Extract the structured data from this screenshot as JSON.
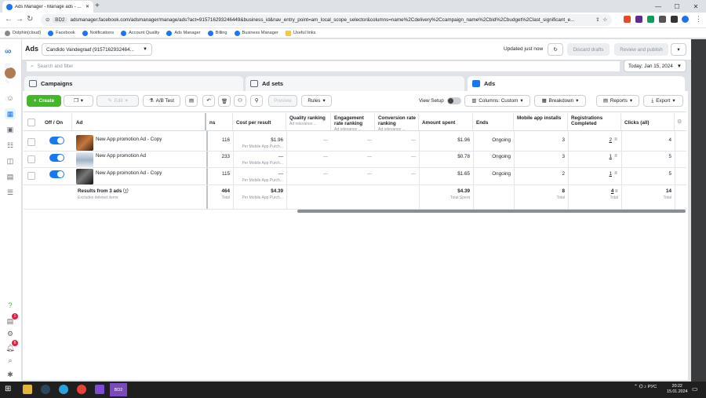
{
  "browser": {
    "tab_title": "Ads Manager - Manage ads - A...",
    "new_tab": "+",
    "url_chip": "BD2",
    "url": "adsmanager.facebook.com/adsmanager/manage/ads?act=915716293246449&business_id&nav_entry_point=am_local_scope_selector&columns=name%2Cdelivery%2Ccampaign_name%2Cbid%2Cbudget%2Clast_significant_e...",
    "bookmarks": [
      "Dolphin{cloud}",
      "Facebook",
      "Notifications",
      "Account Quality",
      "Ads Manager",
      "Billing",
      "Business Manager",
      "Useful links"
    ]
  },
  "header": {
    "title": "Ads",
    "account": "Candido Vandegraaf (9157162932464...",
    "updated": "Updated just now",
    "discard_drafts": "Discard drafts",
    "review_publish": "Review and publish"
  },
  "search": {
    "placeholder": "Search and filter"
  },
  "date_range": "Today: Jan 15, 2024",
  "level_tabs": {
    "campaigns": "Campaigns",
    "adsets": "Ad sets",
    "ads": "Ads"
  },
  "toolbar": {
    "create": "Create",
    "edit": "Edit",
    "ab_test": "A/B Test",
    "preview": "Preview",
    "rules": "Rules",
    "view_setup": "View Setup",
    "columns": "Columns: Custom",
    "breakdown": "Breakdown",
    "reports": "Reports",
    "export": "Export"
  },
  "table": {
    "headers": {
      "off_on": "Off / On",
      "ad": "Ad",
      "results_partial": "ns",
      "cost_per_result": "Cost per result",
      "quality_ranking": "Quality ranking",
      "quality_sub": "Ad relevance ...",
      "engagement_ranking": "Engagement rate ranking",
      "engagement_sub": "Ad relevance ...",
      "conversion_ranking": "Conversion rate ranking",
      "conversion_sub": "Ad relevance ...",
      "amount_spent": "Amount spent",
      "ends": "Ends",
      "mobile_installs": "Mobile app installs",
      "registrations": "Registrations Completed",
      "clicks": "Clicks (all)"
    },
    "rows": [
      {
        "name": "New App promotion Ad - Copy",
        "results": "116",
        "cost": "$1.96",
        "cost_sub": "Per Mobile App Purch...",
        "quality": "—",
        "engagement": "—",
        "conversion": "—",
        "spent": "$1.96",
        "ends": "Ongoing",
        "installs": "3",
        "registrations": "2",
        "clicks": "4"
      },
      {
        "name": "New App promotion Ad",
        "results": "233",
        "cost": "—",
        "cost_sub": "Per Mobile App Purch...",
        "quality": "—",
        "engagement": "—",
        "conversion": "—",
        "spent": "$0.78",
        "ends": "Ongoing",
        "installs": "3",
        "registrations": "1",
        "clicks": "5"
      },
      {
        "name": "New App promotion Ad - Copy",
        "results": "115",
        "cost": "—",
        "cost_sub": "Per Mobile App Purch...",
        "quality": "—",
        "engagement": "—",
        "conversion": "—",
        "spent": "$1.65",
        "ends": "Ongoing",
        "installs": "2",
        "registrations": "1",
        "clicks": "5"
      }
    ],
    "summary": {
      "label": "Results from 3 ads",
      "sub": "Excludes deleted items",
      "results": "464",
      "results_sub": "Total",
      "cost": "$4.39",
      "cost_sub": "Per Mobile App Purch...",
      "spent": "$4.39",
      "spent_sub": "Total Spent",
      "installs": "8",
      "installs_sub": "Total",
      "registrations": "4",
      "registrations_sub": "Total",
      "clicks": "14",
      "clicks_sub": "Total"
    }
  },
  "left_rail": {
    "badge_ads": "1",
    "badge_notifications": "6"
  },
  "taskbar": {
    "lang": "РУС",
    "time": "20:22",
    "date": "15.01.2024",
    "app_label": "BD2"
  },
  "colors": {
    "accent": "#1877f2",
    "create": "#42b72a"
  }
}
